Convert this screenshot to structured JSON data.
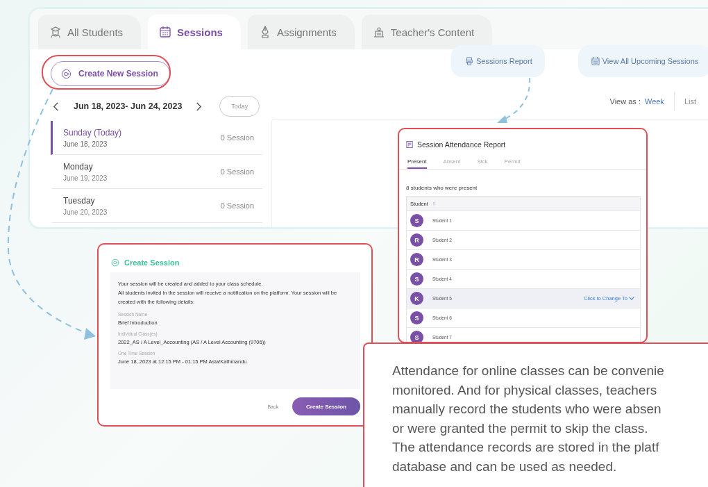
{
  "tabs": [
    {
      "label": "All Students",
      "selected": false
    },
    {
      "label": "Sessions",
      "selected": true
    },
    {
      "label": "Assignments",
      "selected": false
    },
    {
      "label": "Teacher's Content",
      "selected": false
    }
  ],
  "create_button": "Create New Session",
  "report_button": "Sessions Report",
  "upcoming_button": "View All Upcoming Sessions",
  "date_range": "Jun 18, 2023- Jun 24, 2023",
  "today_button": "Today",
  "view_as": {
    "label": "View as :",
    "options": [
      {
        "label": "Week",
        "selected": true
      },
      {
        "label": "List",
        "selected": false
      }
    ]
  },
  "days": [
    {
      "day": "Sunday (Today)",
      "date": "June 18, 2023",
      "count": "0 Session",
      "selected": true
    },
    {
      "day": "Monday",
      "date": "June 19, 2023",
      "count": "0 Session",
      "selected": false
    },
    {
      "day": "Tuesday",
      "date": "June 20, 2023",
      "count": "0 Session",
      "selected": false
    }
  ],
  "attendance": {
    "title": "Session Attendance Report",
    "tabs": [
      {
        "label": "Present",
        "selected": true
      },
      {
        "label": "Absent",
        "selected": false
      },
      {
        "label": "Sick",
        "selected": false
      },
      {
        "label": "Permit",
        "selected": false
      }
    ],
    "summary": "8 students who were present",
    "column": "Student",
    "sort_icon": "↑",
    "students": [
      {
        "initial": "S",
        "name": "Student 1",
        "selected": false
      },
      {
        "initial": "R",
        "name": "Student 2",
        "selected": false
      },
      {
        "initial": "R",
        "name": "Student 3",
        "selected": false
      },
      {
        "initial": "S",
        "name": "Student 4",
        "selected": false
      },
      {
        "initial": "K",
        "name": "Student 5",
        "action": "Click to Change To",
        "selected": true
      },
      {
        "initial": "S",
        "name": "Student 6",
        "selected": false
      },
      {
        "initial": "S",
        "name": "Student 7",
        "selected": false
      }
    ]
  },
  "create_session": {
    "title": "Create Session",
    "intro": [
      "Your session will be created and added to your class schedule.",
      "All students invited in the session will receive a notification on the platform. Your session will be created with the following details:"
    ],
    "fields": [
      {
        "label": "Session Name",
        "value": "Brief Introduction"
      },
      {
        "label": "Individual Class(es)",
        "value": "2022_AS / A Level_Accounting (AS / A Level Accounting (9706))"
      },
      {
        "label": "One Time Session",
        "value": "June 18, 2023 at 12:15 PM - 01:15 PM Asia/Kathmandu"
      }
    ],
    "back": "Back",
    "submit": "Create Session"
  },
  "callout": [
    "Attendance for online classes can be convenie",
    "monitored. And for physical classes, teachers",
    "manually record the students who were absen",
    "or were granted the permit to skip the class.",
    "The attendance records are stored in the platf",
    "database and can be used as needed."
  ]
}
